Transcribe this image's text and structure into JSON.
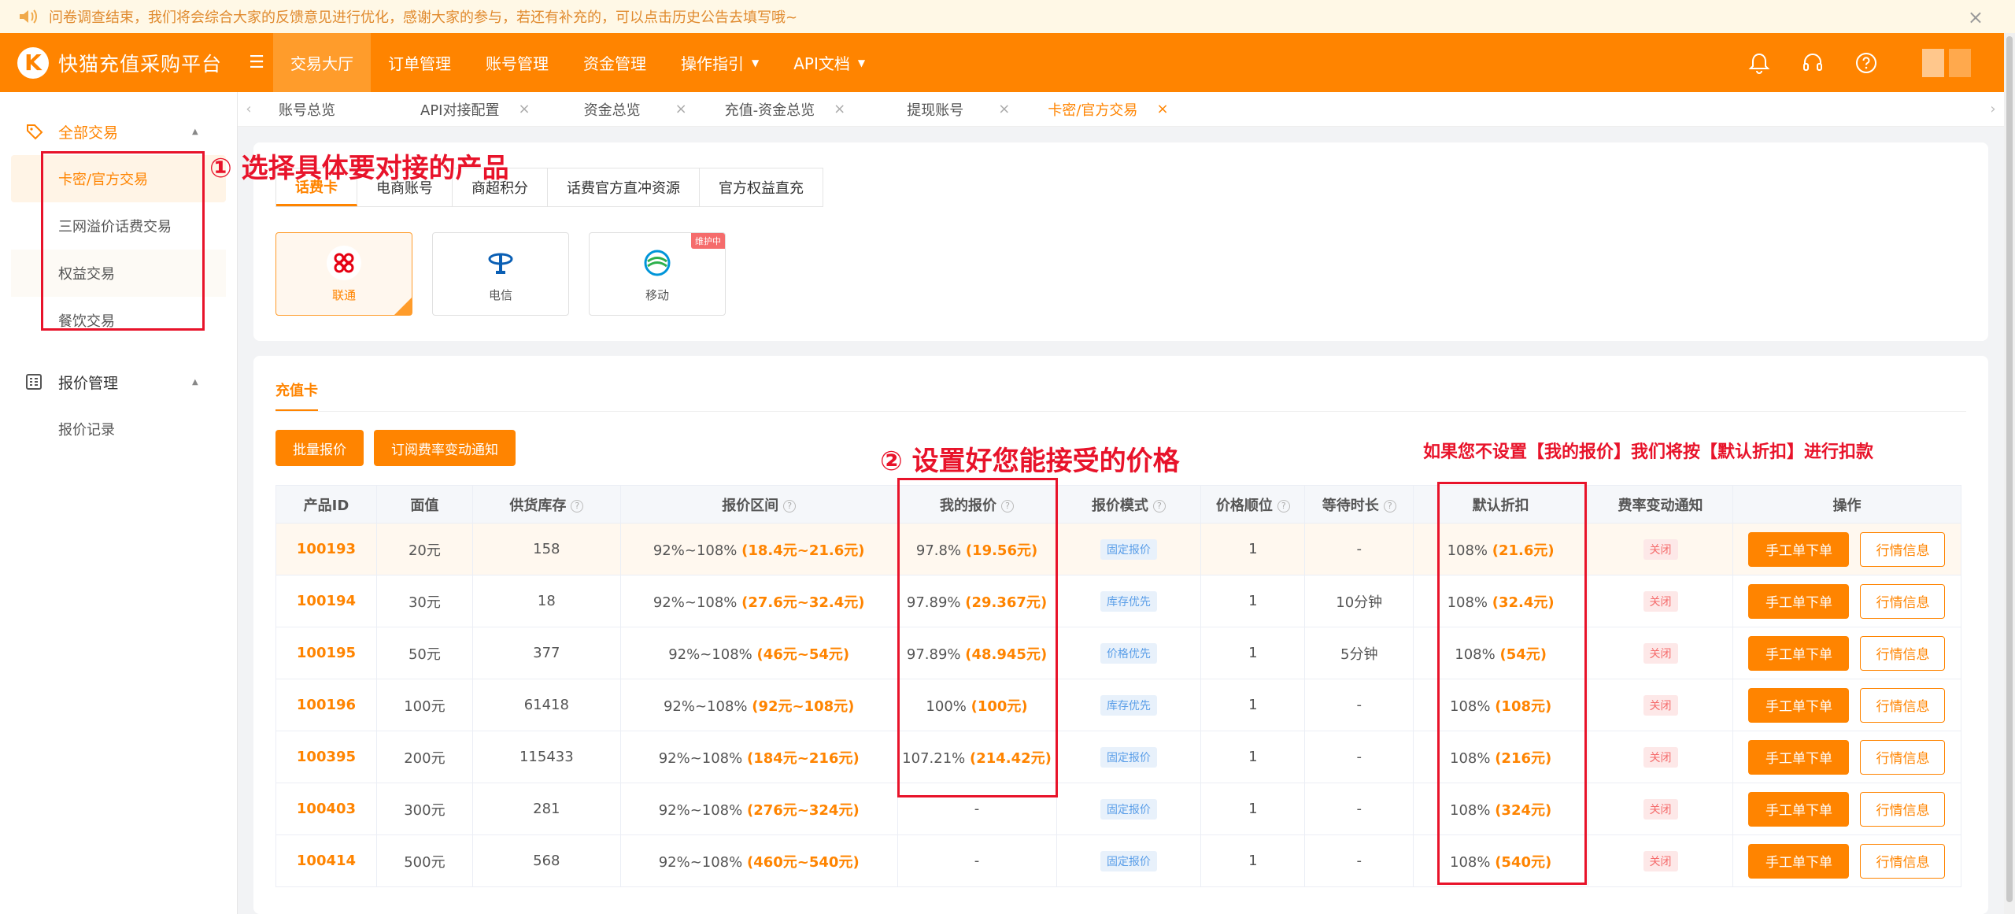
{
  "notice": {
    "text": "问卷调查结束，我们将会综合大家的反馈意见进行优化，感谢大家的参与，若还有补充的，可以点击历史公告去填写哦~",
    "close": "×"
  },
  "header": {
    "logo_letter": "K",
    "title": "快猫充值采购平台",
    "menu_icon": "☰",
    "nav": [
      {
        "label": "交易大厅",
        "active": true
      },
      {
        "label": "订单管理"
      },
      {
        "label": "账号管理"
      },
      {
        "label": "资金管理"
      },
      {
        "label": "操作指引",
        "caret": "▼"
      },
      {
        "label": "API文档",
        "caret": "▼"
      }
    ],
    "icons": [
      "bell-icon",
      "headset-icon",
      "help-icon"
    ]
  },
  "sidebar": {
    "groups": [
      {
        "label": "全部交易",
        "icon": "tag-icon",
        "arrow": "▲"
      },
      {
        "label": "报价管理",
        "icon": "grid-icon",
        "arrow": "▲"
      }
    ],
    "items": [
      {
        "label": "卡密/官方交易"
      },
      {
        "label": "三网溢价话费交易"
      },
      {
        "label": "权益交易"
      },
      {
        "label": "餐饮交易"
      },
      {
        "label": "报价记录"
      }
    ]
  },
  "tabs": {
    "left_arrow": "‹",
    "right_arrow": "›",
    "items": [
      {
        "label": "账号总览"
      },
      {
        "label": "API对接配置",
        "close": "×"
      },
      {
        "label": "资金总览",
        "close": "×"
      },
      {
        "label": "充值-资金总览",
        "close": "×"
      },
      {
        "label": "提现账号",
        "close": "×"
      },
      {
        "label": "卡密/官方交易",
        "close": "×",
        "active": true
      }
    ]
  },
  "categories": [
    "话费卡",
    "电商账号",
    "商超积分",
    "话费官方直冲资源",
    "官方权益直充"
  ],
  "carriers": [
    {
      "label": "联通",
      "selected": true
    },
    {
      "label": "电信"
    },
    {
      "label": "移动",
      "badge": "维护中"
    }
  ],
  "section": {
    "tab": "充值卡",
    "buttons": [
      "批量报价",
      "订阅费率变动通知"
    ]
  },
  "table": {
    "headers": [
      "产品ID",
      "面值",
      "供货库存",
      "报价区间",
      "我的报价",
      "报价模式",
      "价格顺位",
      "等待时长",
      "默认折扣",
      "费率变动通知",
      "操作"
    ],
    "help_mark": "?",
    "rows": [
      {
        "id": "100193",
        "face": "20元",
        "stock": "158",
        "range_pct": "92%~108%",
        "range_amt": "(18.4元~21.6元)",
        "my_pct": "97.8%",
        "my_amt": "(19.56元)",
        "mode": "固定报价",
        "rank": "1",
        "wait": "-",
        "disc_pct": "108%",
        "disc_amt": "(21.6元)",
        "notify": "关闭",
        "op1": "手工单下单",
        "op2": "行情信息"
      },
      {
        "id": "100194",
        "face": "30元",
        "stock": "18",
        "range_pct": "92%~108%",
        "range_amt": "(27.6元~32.4元)",
        "my_pct": "97.89%",
        "my_amt": "(29.367元)",
        "mode": "库存优先",
        "rank": "1",
        "wait": "10分钟",
        "disc_pct": "108%",
        "disc_amt": "(32.4元)",
        "notify": "关闭",
        "op1": "手工单下单",
        "op2": "行情信息"
      },
      {
        "id": "100195",
        "face": "50元",
        "stock": "377",
        "range_pct": "92%~108%",
        "range_amt": "(46元~54元)",
        "my_pct": "97.89%",
        "my_amt": "(48.945元)",
        "mode": "价格优先",
        "rank": "1",
        "wait": "5分钟",
        "disc_pct": "108%",
        "disc_amt": "(54元)",
        "notify": "关闭",
        "op1": "手工单下单",
        "op2": "行情信息"
      },
      {
        "id": "100196",
        "face": "100元",
        "stock": "61418",
        "range_pct": "92%~108%",
        "range_amt": "(92元~108元)",
        "my_pct": "100%",
        "my_amt": "(100元)",
        "mode": "库存优先",
        "rank": "1",
        "wait": "-",
        "disc_pct": "108%",
        "disc_amt": "(108元)",
        "notify": "关闭",
        "op1": "手工单下单",
        "op2": "行情信息"
      },
      {
        "id": "100395",
        "face": "200元",
        "stock": "115433",
        "range_pct": "92%~108%",
        "range_amt": "(184元~216元)",
        "my_pct": "107.21%",
        "my_amt": "(214.42元)",
        "mode": "固定报价",
        "rank": "1",
        "wait": "-",
        "disc_pct": "108%",
        "disc_amt": "(216元)",
        "notify": "关闭",
        "op1": "手工单下单",
        "op2": "行情信息"
      },
      {
        "id": "100403",
        "face": "300元",
        "stock": "281",
        "range_pct": "92%~108%",
        "range_amt": "(276元~324元)",
        "my_pct": "-",
        "my_amt": "",
        "mode": "固定报价",
        "rank": "1",
        "wait": "-",
        "disc_pct": "108%",
        "disc_amt": "(324元)",
        "notify": "关闭",
        "op1": "手工单下单",
        "op2": "行情信息"
      },
      {
        "id": "100414",
        "face": "500元",
        "stock": "568",
        "range_pct": "92%~108%",
        "range_amt": "(460元~540元)",
        "my_pct": "-",
        "my_amt": "",
        "mode": "固定报价",
        "rank": "1",
        "wait": "-",
        "disc_pct": "108%",
        "disc_amt": "(540元)",
        "notify": "关闭",
        "op1": "手工单下单",
        "op2": "行情信息"
      }
    ]
  },
  "annotations": {
    "a1": "① 选择具体要对接的产品",
    "a2": "② 设置好您能接受的价格",
    "a3": "如果您不设置【我的报价】我们将按【默认折扣】进行扣款"
  },
  "colors": {
    "brand": "#ff8400",
    "annotation": "#e8132a"
  }
}
